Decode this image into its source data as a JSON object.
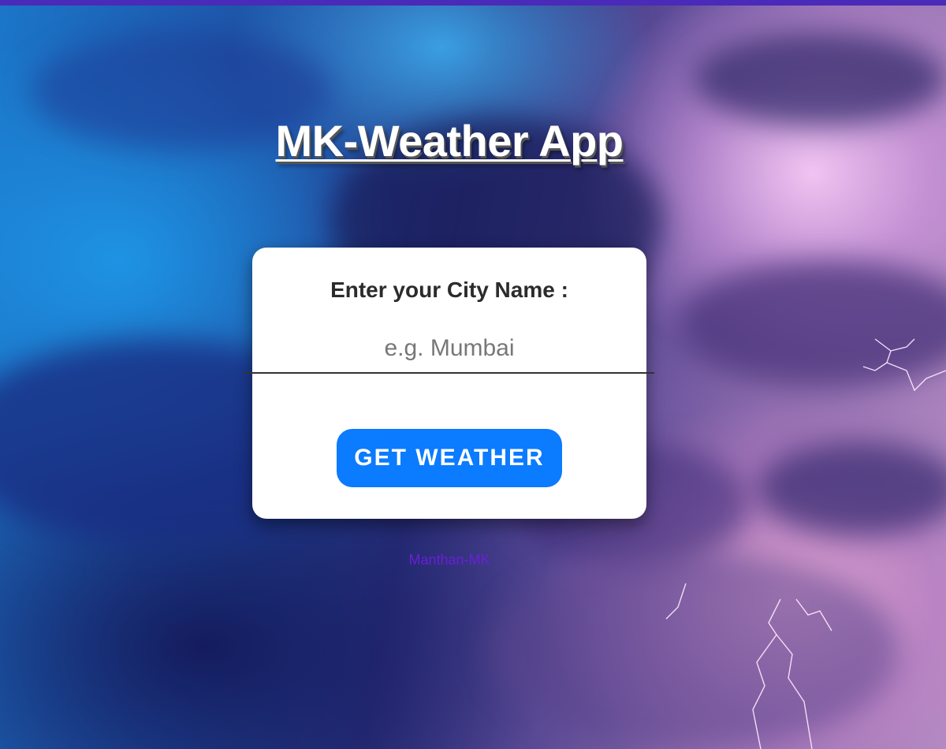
{
  "app": {
    "title": "MK-Weather App"
  },
  "form": {
    "label": "Enter your City Name :",
    "city_input": {
      "value": "",
      "placeholder": "e.g. Mumbai"
    },
    "submit_label": "GET WEATHER"
  },
  "footer": {
    "credit": "Manthan-MK"
  },
  "colors": {
    "accent": "#0b7bff",
    "top_bar": "#4a2ab8",
    "credit_link": "#6a1fd6"
  },
  "background": {
    "description_icon": "storm-sky-image"
  }
}
